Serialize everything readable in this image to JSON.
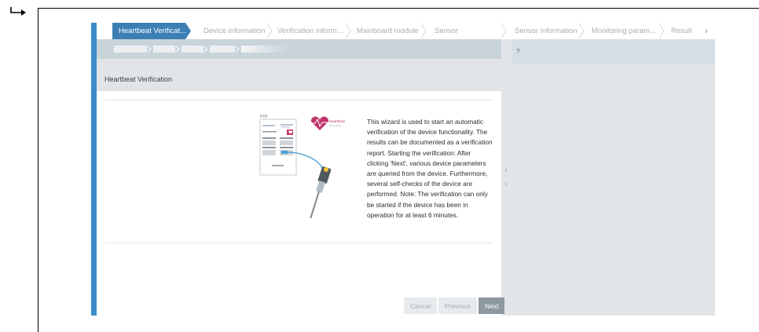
{
  "wizard": {
    "steps": [
      {
        "label": "Heartbeat Verificat..."
      },
      {
        "label": "Device information"
      },
      {
        "label": "Verification inform..."
      },
      {
        "label": "Mainboard module"
      },
      {
        "label": "Sensor"
      },
      {
        "label": "Sensor information"
      },
      {
        "label": "Monitoring param..."
      },
      {
        "label": "Result"
      }
    ],
    "more_glyph": "›"
  },
  "help": {
    "mark": "?"
  },
  "panel": {
    "title": "Heartbeat Verification",
    "description": "This wizard is used to start an automatic verification of the device functionality. The results can be documented as a verification report. Starting the verification: After clicking 'Next', various device parameters are queried from the device. Furthermore, several self-checks of the device are performed. Note: The verification can only be started if the device has been in operation for at least 6 minutes."
  },
  "illustration": {
    "doc_label": "PDF",
    "brand_line1": "Heartbeat",
    "brand_line2": "Technology"
  },
  "buttons": {
    "cancel": "Cancel",
    "previous": "Previous",
    "next": "Next"
  },
  "side_nav": {
    "collapse": "‹",
    "expand": "›"
  },
  "colors": {
    "accent": "#3c8dc8",
    "active_step": "#3c7fb5",
    "heart": "#c0356b"
  }
}
